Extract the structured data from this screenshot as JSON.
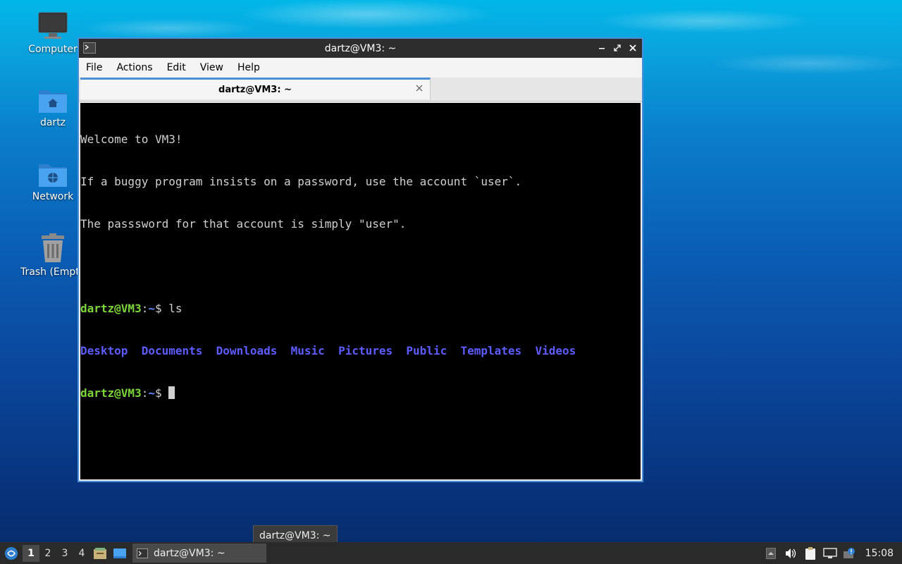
{
  "desktop": {
    "icons": [
      {
        "label": "Computer",
        "icon": "computer-icon"
      },
      {
        "label": "dartz",
        "icon": "home-folder-icon"
      },
      {
        "label": "Network",
        "icon": "network-folder-icon"
      },
      {
        "label": "Trash (Empty)",
        "icon": "trash-icon"
      }
    ]
  },
  "window": {
    "title": "dartz@VM3: ~",
    "menu": [
      "File",
      "Actions",
      "Edit",
      "View",
      "Help"
    ],
    "tab_label": "dartz@VM3: ~"
  },
  "terminal": {
    "welcome": [
      "Welcome to VM3!",
      "If a buggy program insists on a password, use the account `user`.",
      "The passsword for that account is simply \"user\"."
    ],
    "prompt_user": "dartz@VM3",
    "prompt_sep": ":",
    "prompt_path": "~",
    "prompt_symbol": "$ ",
    "command": "ls",
    "ls_output": [
      "Desktop",
      "Documents",
      "Downloads",
      "Music",
      "Pictures",
      "Public",
      "Templates",
      "Videos"
    ]
  },
  "tooltip": "dartz@VM3: ~",
  "taskbar": {
    "workspaces": [
      "1",
      "2",
      "3",
      "4"
    ],
    "task_label": "dartz@VM3: ~",
    "clock": "15:08"
  },
  "colors": {
    "accent": "#4a90d9",
    "prompt_green": "#7cd53a",
    "dir_blue": "#5c5cff"
  }
}
